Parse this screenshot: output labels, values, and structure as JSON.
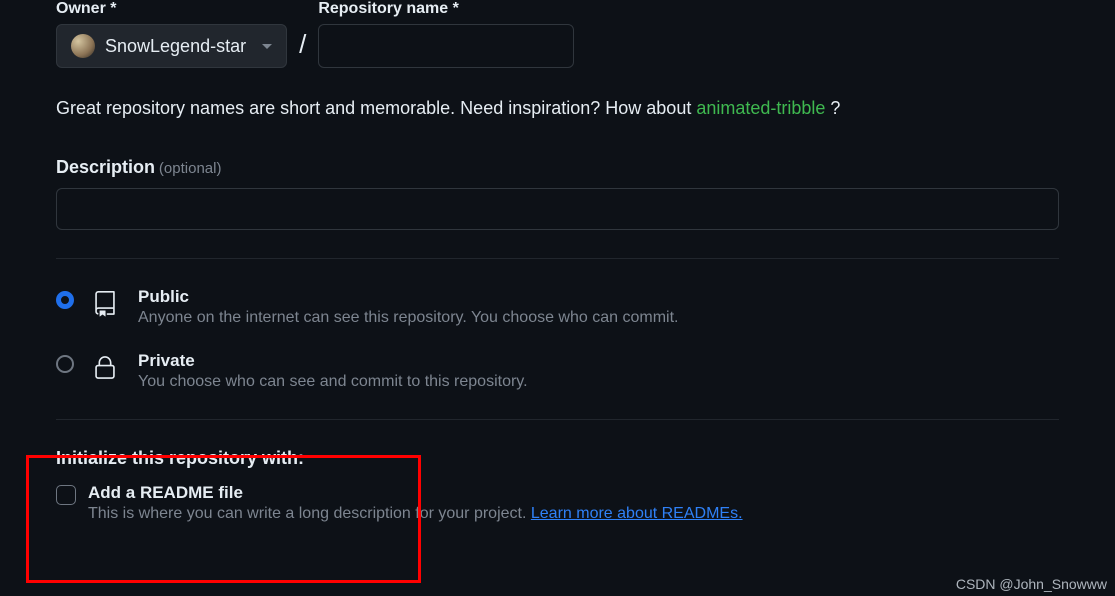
{
  "owner": {
    "label": "Owner *",
    "selected": "SnowLegend-star"
  },
  "repo": {
    "label": "Repository name *",
    "value": ""
  },
  "hint": {
    "prefix": "Great repository names are short and memorable. Need inspiration? How about ",
    "suggestion": "animated-tribble",
    "suffix": " ?"
  },
  "description": {
    "label": "Description",
    "optional": "(optional)",
    "value": ""
  },
  "visibility": {
    "public": {
      "title": "Public",
      "desc": "Anyone on the internet can see this repository. You choose who can commit."
    },
    "private": {
      "title": "Private",
      "desc": "You choose who can see and commit to this repository."
    }
  },
  "init": {
    "heading": "Initialize this repository with:",
    "readme": {
      "title": "Add a README file",
      "desc_prefix": "This is where you can write a long description for your project. ",
      "link": "Learn more about READMEs."
    }
  },
  "watermark": "CSDN @John_Snowww"
}
